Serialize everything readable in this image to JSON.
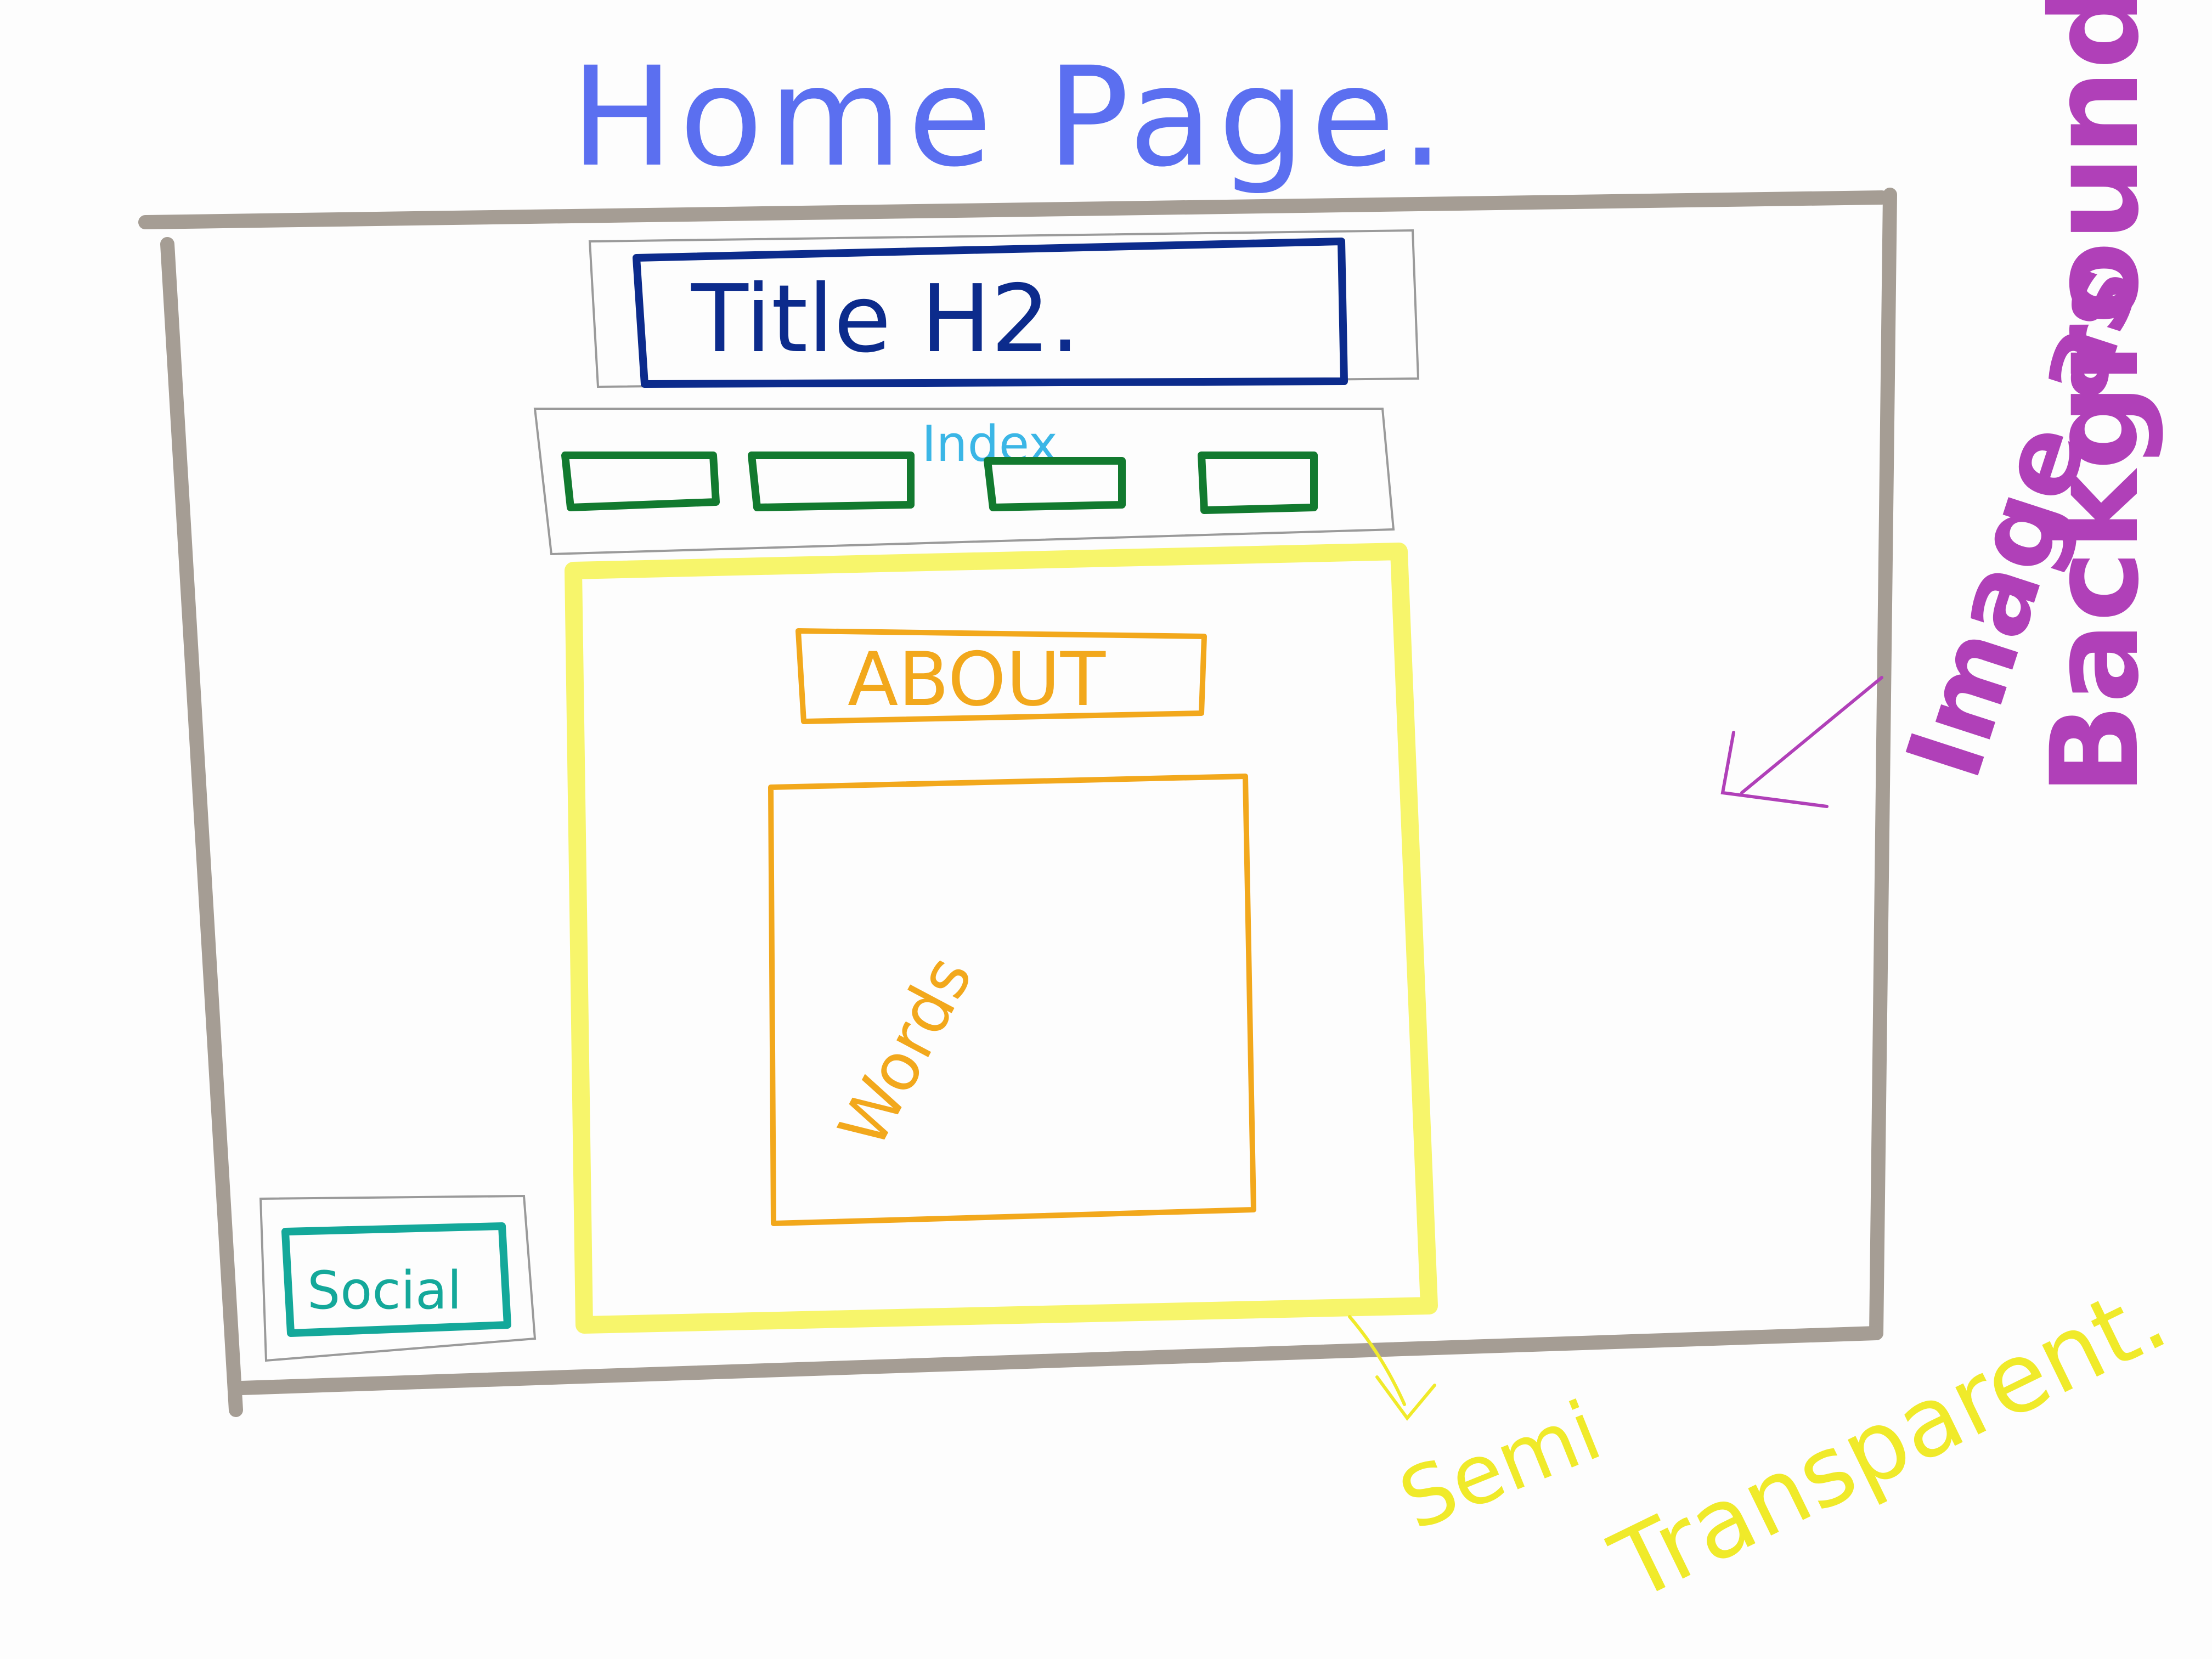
{
  "page_title": "Home Page.",
  "title_box": {
    "label": "Title H2."
  },
  "index_nav": {
    "label": "Index",
    "items": [
      "",
      "",
      "",
      ""
    ]
  },
  "about_box": {
    "label": "ABOUT"
  },
  "words_box": {
    "label": "Words"
  },
  "social_box": {
    "label": "Social"
  },
  "annotations": {
    "background_note_line1": "Image as",
    "background_note_line2": "Background",
    "semi_note_line1": "Semi",
    "semi_note_line2": "Transparent."
  },
  "colors": {
    "page_title": "#5b6ff0",
    "frame": "#a59d94",
    "title_box": "#0c2b8c",
    "nav_buttons": "#127a2f",
    "index_label": "#3bb6e6",
    "content_panel": "#f7f56b",
    "about": "#f2a81c",
    "social": "#14a89a",
    "annotation_background": "#b040b8",
    "annotation_semi": "#f0ea2a",
    "thin_outline": "#9a9a9a"
  }
}
